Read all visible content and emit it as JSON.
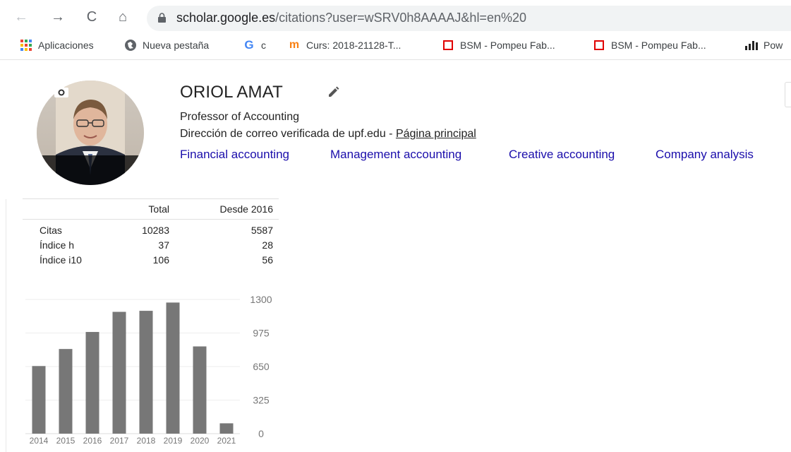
{
  "browser": {
    "url_host": "scholar.google.es",
    "url_path": "/citations?user=wSRV0h8AAAAJ&hl=en%20",
    "bookmarks": [
      {
        "label": "Aplicaciones",
        "icon": "apps-grid-icon"
      },
      {
        "label": "Nueva pestaña",
        "icon": "globe-icon"
      },
      {
        "label": "c",
        "icon": "google-g-icon"
      },
      {
        "label": "Curs: 2018-21128-T...",
        "icon": "moodle-icon"
      },
      {
        "label": "BSM - Pompeu Fab...",
        "icon": "bsm-icon"
      },
      {
        "label": "BSM - Pompeu Fab...",
        "icon": "bsm-icon"
      },
      {
        "label": "Pow",
        "icon": "bars-icon"
      }
    ]
  },
  "profile": {
    "name": "ORIOL AMAT",
    "affiliation": "Professor of Accounting",
    "email_text": "Dirección de correo verificada de upf.edu - ",
    "homepage_label": "Página principal",
    "interests": [
      "Financial accounting",
      "Management accounting",
      "Creative accounting",
      "Company analysis"
    ]
  },
  "stats": {
    "headers": [
      "Total",
      "Desde 2016"
    ],
    "rows": [
      {
        "label": "Citas",
        "total": "10283",
        "since": "5587"
      },
      {
        "label": "Índice h",
        "total": "37",
        "since": "28"
      },
      {
        "label": "Índice i10",
        "total": "106",
        "since": "56"
      }
    ]
  },
  "colors": {
    "link": "#1a0dab",
    "bar": "#777777",
    "bsm_red": "#e00000"
  },
  "chart_data": {
    "type": "bar",
    "categories": [
      "2014",
      "2015",
      "2016",
      "2017",
      "2018",
      "2019",
      "2020",
      "2021"
    ],
    "values": [
      655,
      820,
      985,
      1180,
      1190,
      1270,
      845,
      100
    ],
    "yticks": [
      "1300",
      "975",
      "650",
      "325",
      "0"
    ],
    "ylim": [
      0,
      1300
    ],
    "grid": true,
    "title": "",
    "xlabel": "",
    "ylabel": ""
  }
}
